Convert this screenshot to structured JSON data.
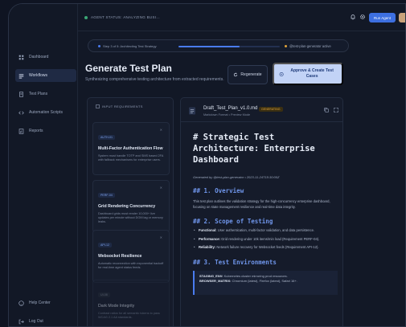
{
  "topbar": {
    "status": "AGENT STATUS: ANALYZING BUSI...",
    "run_label": "Run Agent"
  },
  "sidebar": {
    "items": [
      {
        "label": "Dashboard",
        "icon": "grid-icon"
      },
      {
        "label": "Workflows",
        "icon": "workflow-icon",
        "active": true
      },
      {
        "label": "Test Plans",
        "icon": "document-icon"
      },
      {
        "label": "Automation Scripts",
        "icon": "code-icon"
      },
      {
        "label": "Reports",
        "icon": "report-icon"
      }
    ],
    "bottom": [
      {
        "label": "Help Center",
        "icon": "help-icon"
      },
      {
        "label": "Log Out",
        "icon": "logout-icon"
      }
    ]
  },
  "stepbar": {
    "step_text": "Step 3 of 5: Architecting Test Strategy",
    "progress": 0.6,
    "agent_text": "@test-plan-generator active"
  },
  "header": {
    "title": "Generate Test Plan",
    "subtitle": "Synthesizing comprehensive testing architecture from extracted requirements.",
    "regenerate": "Regenerate",
    "approve": "Approve & Create Test Cases"
  },
  "requirements": {
    "heading": "INPUT REQUIREMENTS",
    "cards": [
      {
        "tag": "AUTH-01",
        "title": "Multi-Factor Authentication Flow",
        "desc": "System must handle TOTP and SMS based 2FA with fallback mechanisms for enterprise users.",
        "x": "✕"
      },
      {
        "tag": "PERF-04",
        "title": "Grid Rendering Concurrency",
        "desc": "Dashboard grids must render 10,000+ live updates per minute without DOM lag or memory leaks.",
        "x": "✕"
      },
      {
        "tag": "API-12",
        "title": "Websocket Resilience",
        "desc": "Automatic reconnection with exponential backoff for real-time agent status feeds.",
        "x": "✕"
      },
      {
        "tag": "UI-08",
        "title": "Dark Mode Integrity",
        "desc": "Contrast ratios for all semantic tokens to pass WCAG 2.1 AA standards.",
        "x": "",
        "dim": true
      }
    ]
  },
  "document": {
    "filename": "Draft_Test_Plan_v1.0.md",
    "badge": "GENERATING",
    "meta": "Markdown Format • Preview Mode",
    "h1": "# Strategic Test Architecture: Enterprise Dashboard",
    "generated": "Generated by @test-plan-generator • 2023-11-24T15:30:00Z",
    "s1_title": "## 1. Overview",
    "s1_text": "This test plan outlines the validation strategy for the high-concurrency enterprise dashboard, focusing on state management resilience and real-time data integrity.",
    "s2_title": "## 2. Scope of Testing",
    "s2_items": [
      {
        "term": "Functional:",
        "text": " User authentication, multi-factor validation, and data persistence."
      },
      {
        "term": "Performance:",
        "text": " Grid rendering under 10k items/min load (Requirement PERF-04)."
      },
      {
        "term": "Reliability:",
        "text": " Network failure recovery for Websocket feeds (Requirement API-12)."
      }
    ],
    "s3_title": "## 3. Test Environments",
    "env_lines": [
      {
        "term": "STAGING_ENV:",
        "text": " Kubernetes cluster mirroring prod resources."
      },
      {
        "term": "BROWSER_MATRIX:",
        "text": " Chromium (latest), Firefox (latest), Safari 16+."
      }
    ]
  },
  "colors": {
    "accent": "#3d6fe0",
    "approve_bg": "#c2d3f6",
    "badge": "#e0a33a",
    "heading": "#6f95ea"
  }
}
